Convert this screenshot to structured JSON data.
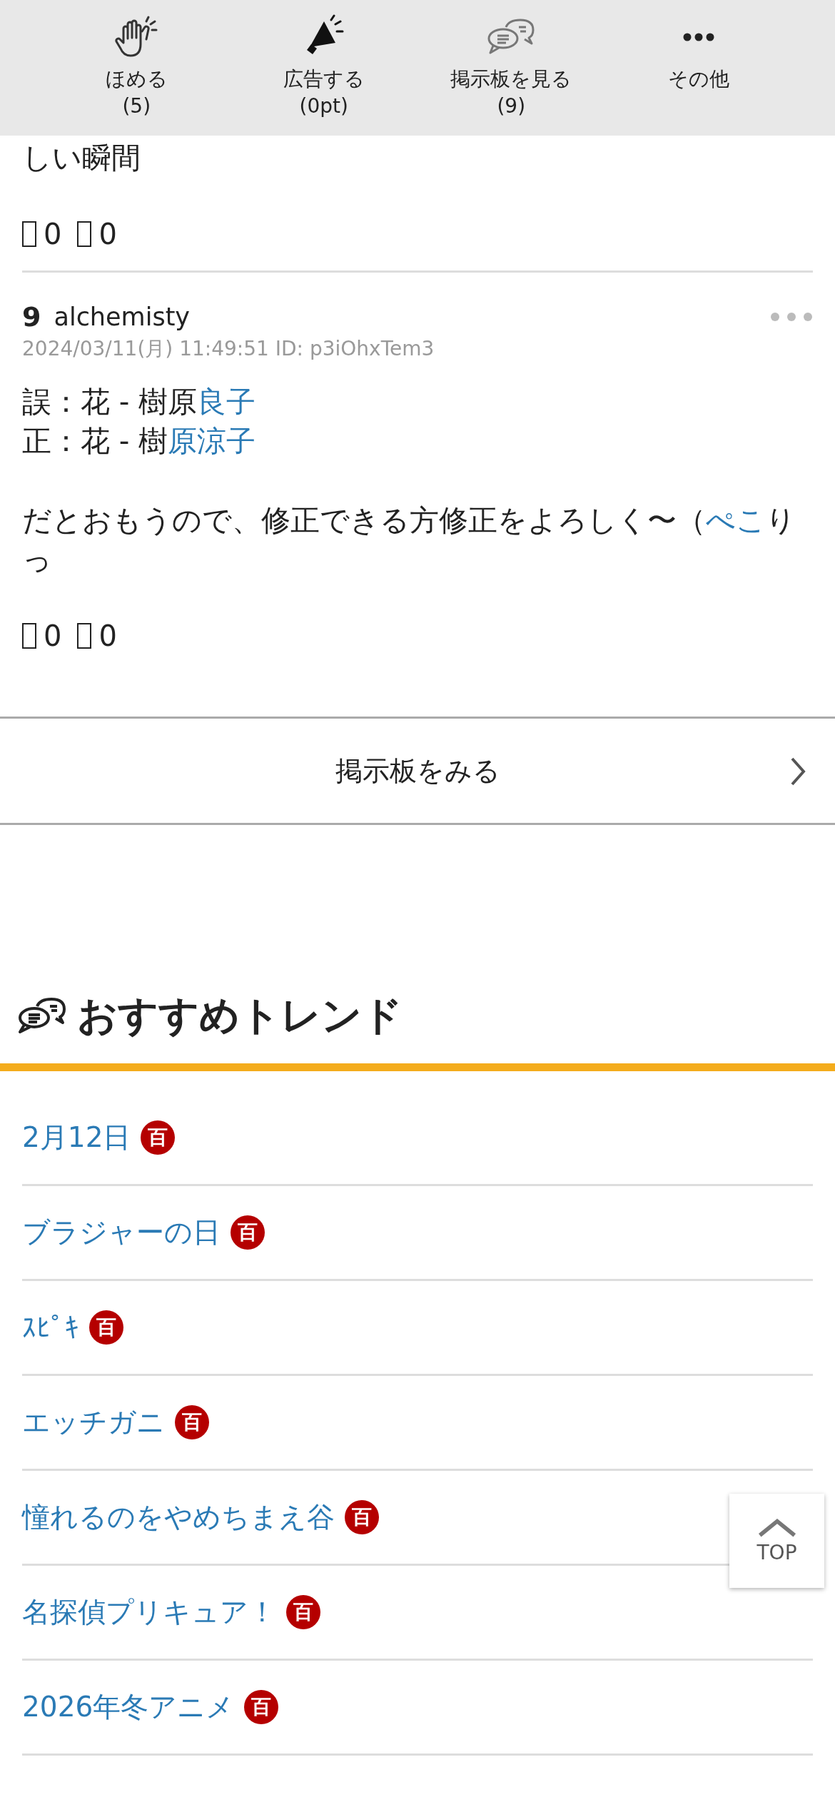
{
  "toolbar": [
    {
      "kind": "clap",
      "label": "ほめる",
      "count": "(5)"
    },
    {
      "kind": "megaphone",
      "label": "広告する",
      "count": "(0pt)"
    },
    {
      "kind": "chat",
      "label": "掲示板を見る",
      "count": "(9)"
    },
    {
      "kind": "more",
      "label": "その他"
    }
  ],
  "previous_comment": {
    "text": "しい瞬間",
    "reactions": [
      {
        "count": "0"
      },
      {
        "count": "0"
      }
    ]
  },
  "comment": {
    "number": "9",
    "user": "alchemisty",
    "meta": "2024/03/11(月) 11:49:51 ID: p3iOhxTem3",
    "paragraphs": [
      [
        [
          {
            "text": "誤：花 - 樹原"
          },
          {
            "text": "良子",
            "link": true
          }
        ],
        [
          {
            "text": "正：花 - 樹"
          },
          {
            "text": "原涼子",
            "link": true
          }
        ]
      ],
      [
        [
          {
            "text": "だとおもうので、修正できる方修正をよろしく〜（"
          },
          {
            "text": "ぺこ",
            "link": true
          },
          {
            "text": "りっ"
          }
        ]
      ]
    ],
    "reactions": [
      {
        "count": "0"
      },
      {
        "count": "0"
      }
    ]
  },
  "board_button": {
    "label": "掲示板をみる"
  },
  "trends": {
    "title": "おすすめトレンド",
    "items": [
      {
        "label": "2月12日",
        "badge": "百"
      },
      {
        "label": "ブラジャーの日",
        "badge": "百"
      },
      {
        "label": "ｽﾋﾟｷ",
        "badge": "百"
      },
      {
        "label": "エッチガニ",
        "badge": "百"
      },
      {
        "label": "憧れるのをやめちまえ谷",
        "badge": "百"
      },
      {
        "label": "名探偵プリキュア！",
        "badge": "百"
      },
      {
        "label": "2026年冬アニメ",
        "badge": "百"
      }
    ]
  },
  "top_button": {
    "label": "TOP"
  }
}
